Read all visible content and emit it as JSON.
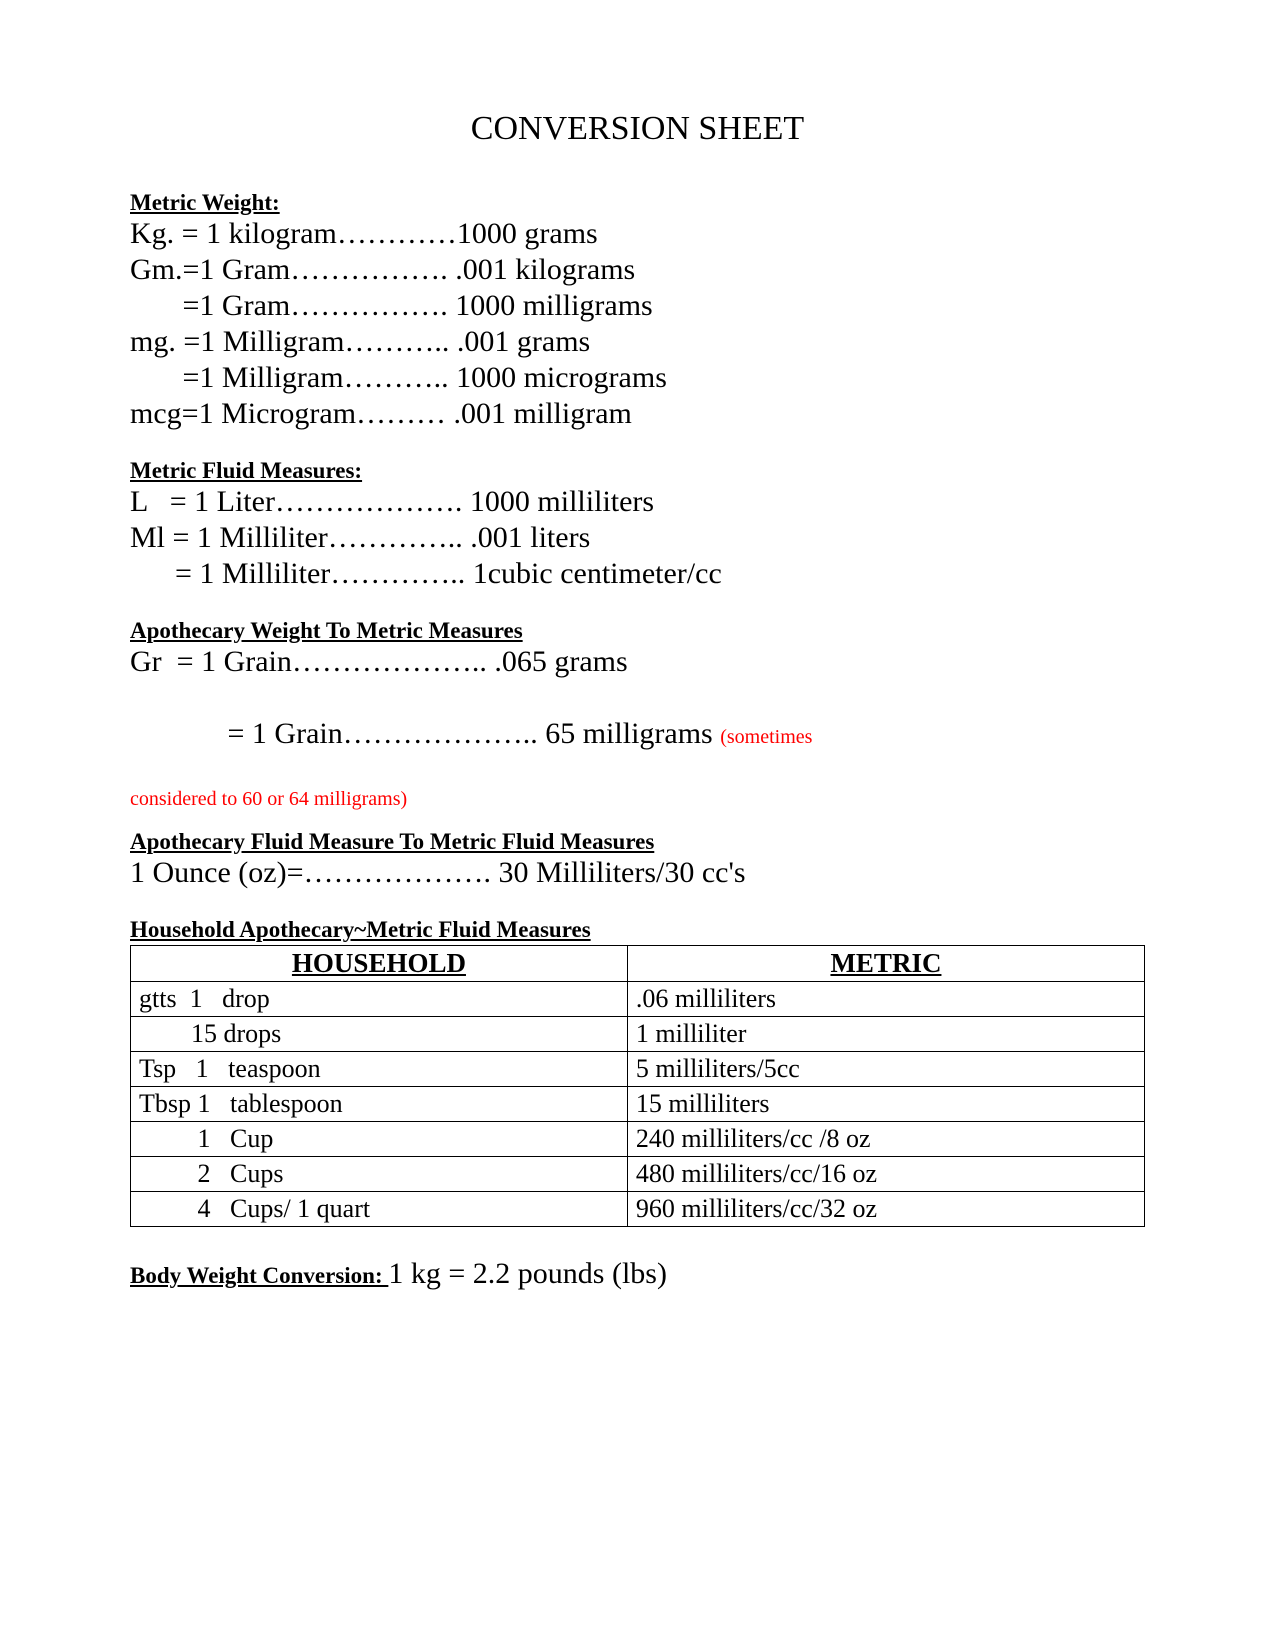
{
  "title": "CONVERSION SHEET",
  "sections": {
    "metric_weight": {
      "heading": "Metric Weight:",
      "lines": [
        "Kg. = 1 kilogram…………1000 grams",
        "Gm.=1 Gram……………. .001 kilograms",
        "       =1 Gram……………. 1000 milligrams",
        "mg. =1 Milligram……….. .001 grams",
        "       =1 Milligram……….. 1000 micrograms",
        "mcg=1 Microgram……… .001 milligram"
      ]
    },
    "metric_fluid": {
      "heading": "Metric Fluid Measures:",
      "lines": [
        "L   = 1 Liter………………. 1000 milliliters",
        "Ml = 1 Milliliter………….. .001 liters",
        "      = 1 Milliliter………….. 1cubic centimeter/cc"
      ]
    },
    "apoth_weight": {
      "heading": "Apothecary Weight To Metric Measures",
      "line1": "Gr  = 1 Grain……………….. .065 grams",
      "line2_left": "       = 1 Grain……………….. 65 milligrams ",
      "line2_note_a": "(sometimes",
      "line2_note_b": "considered to 60 or 64 milligrams)"
    },
    "apoth_fluid": {
      "heading": "Apothecary Fluid Measure To Metric Fluid Measures",
      "line": "1 Ounce (oz)=………………. 30 Milliliters/30 cc's"
    },
    "household": {
      "heading": "Household Apothecary~Metric Fluid Measures",
      "col1": "HOUSEHOLD",
      "col2": "METRIC",
      "rows": [
        {
          "h": "gtts  1   drop",
          "m": ".06 milliliters"
        },
        {
          "h": "        15 drops",
          "m": "1 milliliter"
        },
        {
          "h": "Tsp   1   teaspoon",
          "m": "5 milliliters/5cc"
        },
        {
          "h": "Tbsp 1   tablespoon",
          "m": "15 milliliters"
        },
        {
          "h": "         1   Cup",
          "m": "240 milliliters/cc /8 oz"
        },
        {
          "h": "         2   Cups",
          "m": "480 milliliters/cc/16 oz"
        },
        {
          "h": "         4   Cups/ 1 quart",
          "m": "960 milliliters/cc/32 oz"
        }
      ]
    },
    "body_weight": {
      "label": "Body Weight Conversion:   ",
      "value": "1 kg = 2.2 pounds (lbs)"
    }
  }
}
